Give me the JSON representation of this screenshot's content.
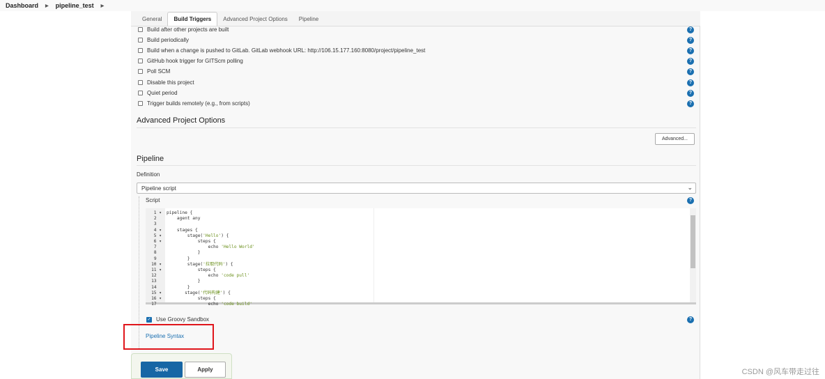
{
  "breadcrumb": {
    "items": [
      "Dashboard",
      "pipeline_test"
    ]
  },
  "tabs": [
    {
      "label": "General"
    },
    {
      "label": "Build Triggers",
      "active": true
    },
    {
      "label": "Advanced Project Options"
    },
    {
      "label": "Pipeline"
    }
  ],
  "triggers": [
    {
      "label": "Build after other projects are built",
      "checked": false
    },
    {
      "label": "Build periodically",
      "checked": false
    },
    {
      "label": "Build when a change is pushed to GitLab. GitLab webhook URL: http://106.15.177.160:8080/project/pipeline_test",
      "checked": false
    },
    {
      "label": "GitHub hook trigger for GITScm polling",
      "checked": false
    },
    {
      "label": "Poll SCM",
      "checked": false
    },
    {
      "label": "Disable this project",
      "checked": false
    },
    {
      "label": "Quiet period",
      "checked": false
    },
    {
      "label": "Trigger builds remotely (e.g., from scripts)",
      "checked": false
    }
  ],
  "advanced": {
    "title": "Advanced Project Options",
    "button": "Advanced..."
  },
  "pipeline": {
    "title": "Pipeline",
    "definition_label": "Definition",
    "definition_value": "Pipeline script",
    "script_label": "Script",
    "code": [
      {
        "n": "1",
        "fold": true,
        "pre": "pipeline {"
      },
      {
        "n": "2",
        "pre": "    agent any"
      },
      {
        "n": "3",
        "pre": ""
      },
      {
        "n": "4",
        "fold": true,
        "pre": "    stages {"
      },
      {
        "n": "5",
        "fold": true,
        "pre": "        stage(",
        "str": "'Hello'",
        "post": ") {"
      },
      {
        "n": "6",
        "fold": true,
        "pre": "            steps {"
      },
      {
        "n": "7",
        "pre": "                echo ",
        "str": "'Hello World'",
        "post": ""
      },
      {
        "n": "8",
        "pre": "            }"
      },
      {
        "n": "9",
        "pre": "        }"
      },
      {
        "n": "10",
        "fold": true,
        "pre": "        stage(",
        "str": "'拉取代码'",
        "post": ") {"
      },
      {
        "n": "11",
        "fold": true,
        "pre": "            steps {"
      },
      {
        "n": "12",
        "pre": "                echo ",
        "str": "'code pull'",
        "post": ""
      },
      {
        "n": "13",
        "pre": "            }"
      },
      {
        "n": "14",
        "pre": "        }"
      },
      {
        "n": "15",
        "fold": true,
        "pre": "       stage(",
        "str": "'代码构建'",
        "post": ") {"
      },
      {
        "n": "16",
        "fold": true,
        "pre": "            steps {"
      },
      {
        "n": "17",
        "pre": "                echo ",
        "str": "'code build'",
        "post": ""
      }
    ],
    "sandbox_label": "Use Groovy Sandbox",
    "sandbox_checked": true,
    "syntax_link": "Pipeline Syntax"
  },
  "footer": {
    "save": "Save",
    "apply": "Apply"
  },
  "colors": {
    "primary": "#1a6fb0",
    "highlight": "#e0151b"
  },
  "watermark": "CSDN @风车带走过往"
}
